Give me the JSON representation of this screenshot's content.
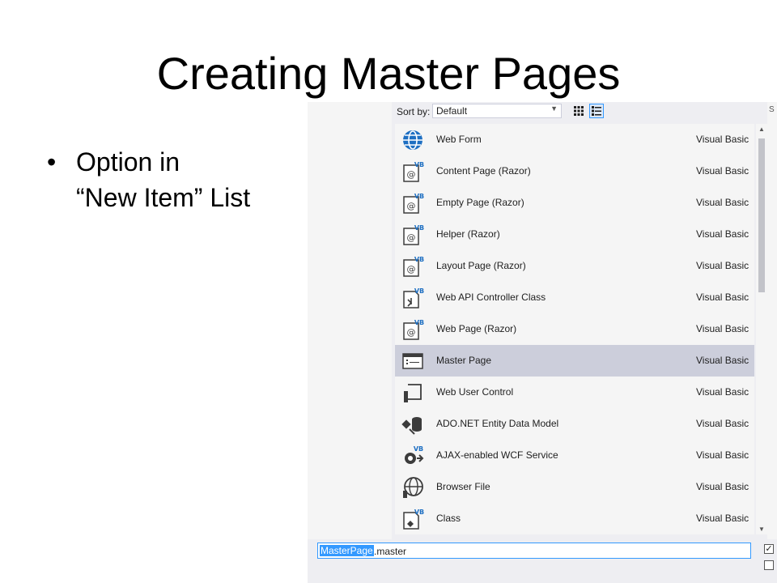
{
  "slide": {
    "title": "Creating Master Pages",
    "bullet": {
      "symbol": "•",
      "line1": "Option in",
      "line2": "“New Item” List"
    }
  },
  "dialog": {
    "sort_label": "Sort by:",
    "sort_value": "Default",
    "right_letter": "S",
    "items": [
      {
        "name": "Web Form",
        "lang": "Visual Basic",
        "icon": "globe-icon"
      },
      {
        "name": "Content Page (Razor)",
        "lang": "Visual Basic",
        "icon": "razor-page-icon"
      },
      {
        "name": "Empty Page (Razor)",
        "lang": "Visual Basic",
        "icon": "razor-page-icon"
      },
      {
        "name": "Helper (Razor)",
        "lang": "Visual Basic",
        "icon": "razor-page-icon"
      },
      {
        "name": "Layout Page (Razor)",
        "lang": "Visual Basic",
        "icon": "razor-page-icon"
      },
      {
        "name": "Web API Controller Class",
        "lang": "Visual Basic",
        "icon": "controller-class-icon"
      },
      {
        "name": "Web Page (Razor)",
        "lang": "Visual Basic",
        "icon": "razor-page-icon"
      },
      {
        "name": "Master Page",
        "lang": "Visual Basic",
        "icon": "master-page-icon"
      },
      {
        "name": "Web User Control",
        "lang": "Visual Basic",
        "icon": "user-control-icon"
      },
      {
        "name": "ADO.NET Entity Data Model",
        "lang": "Visual Basic",
        "icon": "entity-model-icon"
      },
      {
        "name": "AJAX-enabled WCF Service",
        "lang": "Visual Basic",
        "icon": "wcf-service-icon"
      },
      {
        "name": "Browser File",
        "lang": "Visual Basic",
        "icon": "browser-file-icon"
      },
      {
        "name": "Class",
        "lang": "Visual Basic",
        "icon": "class-icon"
      }
    ],
    "selected_index": 7,
    "vb_badge": "VB",
    "name_field": {
      "selected": "MasterPage",
      "rest": ".master"
    },
    "checkbox_checked_mark": "✓"
  }
}
